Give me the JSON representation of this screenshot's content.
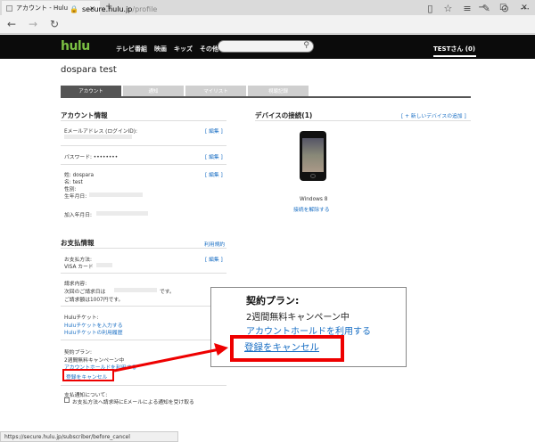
{
  "browser": {
    "tab_title": "アカウント - Hulu",
    "tab_close": "×",
    "new_tab": "+",
    "url_host": "secure.hulu.jp",
    "url_path": "/profile",
    "status_url": "https://secure.hulu.jp/subscriber/before_cancel"
  },
  "header": {
    "logo": "hulu",
    "nav": [
      "テレビ番組",
      "映画",
      "キッズ",
      "その他"
    ],
    "user": "TESTさん (0)"
  },
  "page": {
    "title": "dospara test",
    "tabs": [
      "アカウント",
      "通知",
      "マイリスト",
      "視聴記録"
    ]
  },
  "account": {
    "heading": "アカウント情報",
    "edit": "[ 編集 ]",
    "email_label": "Eメールアドレス (ログインID):",
    "password_label": "パスワード: ••••••••",
    "surname": "姓: dospara",
    "given": "名: test",
    "gender": "性別:",
    "birth": "生年月日:",
    "joined": "加入年月日:"
  },
  "devices": {
    "heading": "デバイスの接続(1)",
    "add": "[ + 新しいデバイスの追加 ]",
    "device_name": "Windows 8",
    "unlink": "接続を解除する"
  },
  "billing": {
    "heading": "お支払情報",
    "terms": "利用規約",
    "edit": "[ 編集 ]",
    "method_label": "お支払方法:",
    "method_value": "VISA カード",
    "request_label": "請求内容:",
    "next_bill": "次回のご請求日は",
    "next_bill_suffix": "です。",
    "amount": "ご請求額は1007円です。",
    "ticket_label": "Huluチケット:",
    "ticket_link1": "Huluチケットを入力する",
    "ticket_link2": "Huluチケットの利用履歴",
    "plan_label": "契約プラン:",
    "plan_value": "2週間無料キャンペーン中",
    "plan_link": "アカウントホールドを利用する",
    "cancel": "登録をキャンセル",
    "notify_label": "支払通知について:",
    "notify_check": "お支払方法へ請求時にEメールによる通知を受け取る"
  },
  "callout": {
    "title": "契約プラン:",
    "plan": "2週間無料キャンペーン中",
    "hold_link": "アカウントホールドを利用する",
    "cancel": "登録をキャンセル"
  },
  "colors": {
    "accent_link": "#1a6fc4",
    "highlight": "#e00000",
    "hulu_green": "#7bc043"
  }
}
